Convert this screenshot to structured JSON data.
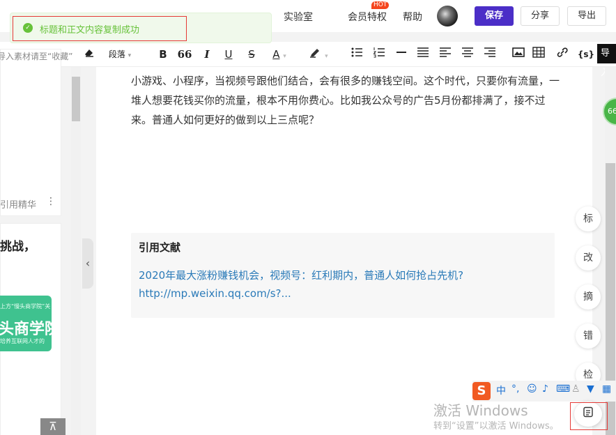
{
  "header": {
    "nav": [
      "实验室",
      "会员特权",
      "帮助"
    ],
    "hot_badge": "HOT",
    "save_label": "保存",
    "share_label": "分享",
    "export_label": "导出"
  },
  "toast": {
    "icon": "check-circle-icon",
    "message": "标题和正文内容复制成功"
  },
  "toolbar": {
    "paragraph_label": "段落",
    "bold": "B",
    "quote": "66",
    "italic": "I",
    "underline": "U",
    "strike": "S",
    "font_color": "A",
    "code_label": "{s}",
    "import_label": "导入"
  },
  "left_panel": {
    "drop_hint": "导入素材请至“收藏”",
    "ref_essence": "引用精华",
    "card_title": "挑战，",
    "thumb": {
      "top_text": "上方“慢头商学院”关",
      "big_text": "头商学院",
      "bottom_text": "培养互联网人才的"
    }
  },
  "editor": {
    "body_text": "小游戏、小程序，当视频号跟他们结合，会有很多的赚钱空间。这个时代，只要你有流量，一堆人想要花钱买你的流量，根本不用你费心。比如我公众号的广告5月份都排满了，接不过来。普通人如何更好的做到以上三点呢？",
    "references": {
      "title": "引用文献",
      "link_text": "2020年最大涨粉赚钱机会，视频号：红利期内，普通人如何抢占先机?http://mp.weixin.qq.com/s?..."
    }
  },
  "right_panel": {
    "badge": "66",
    "side_buttons": [
      "标",
      "改",
      "摘",
      "错",
      "检"
    ]
  },
  "ime": {
    "logo": "S",
    "lang": "中"
  },
  "watermark": {
    "line1": "激活 Windows",
    "line2": "转到“设置”以激活 Windows。"
  }
}
